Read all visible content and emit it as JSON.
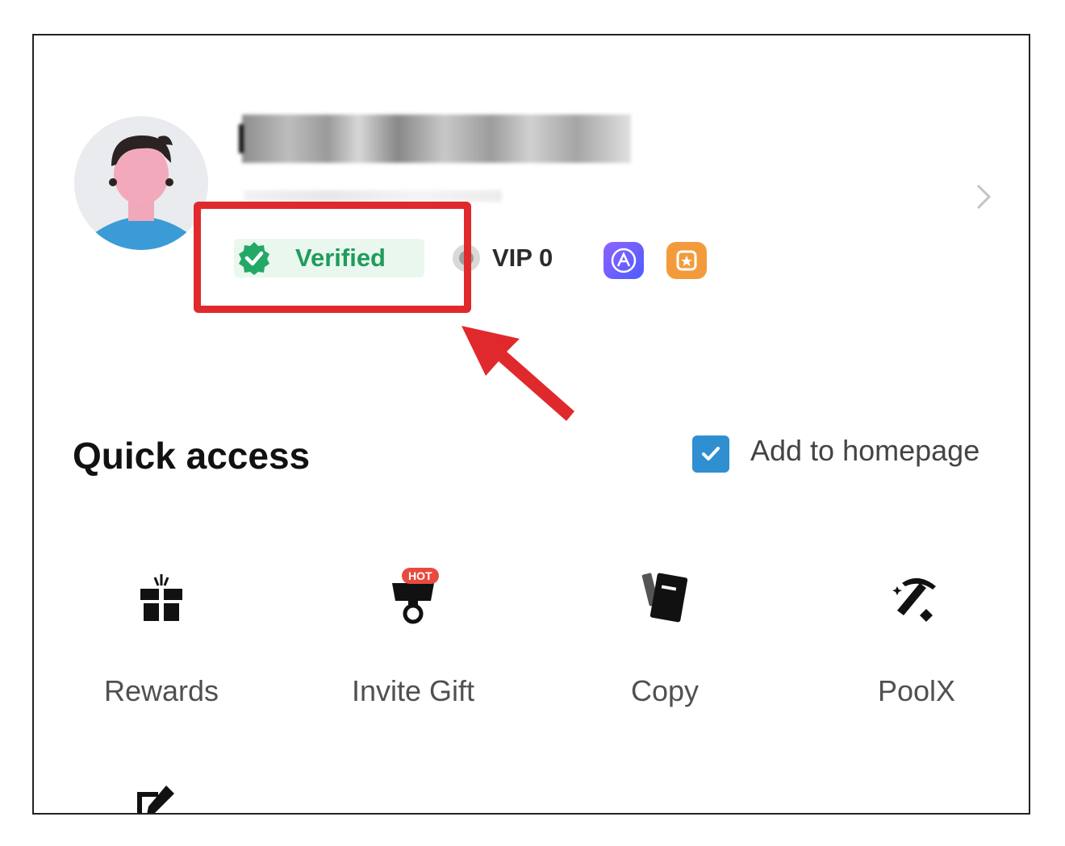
{
  "profile": {
    "avatar_icon": "user-avatar-icon",
    "verified_label": "Verified",
    "vip_label": "VIP 0",
    "chevron_icon": "chevron-right-icon",
    "colors": {
      "verified_bg": "#e9f7ef",
      "verified_text": "#1f9c5a"
    }
  },
  "badges": [
    {
      "icon": "purple-badge-icon",
      "color": "#6b5cff"
    },
    {
      "icon": "orange-badge-icon",
      "color": "#f39b3c"
    }
  ],
  "highlight": {
    "color": "#e0292c"
  },
  "quick_access": {
    "title": "Quick access",
    "add_to_homepage_label": "Add to homepage",
    "checkbox_checked": true,
    "items": [
      {
        "label": "Rewards",
        "icon": "gift-icon"
      },
      {
        "label": "Invite Gift",
        "icon": "invite-gift-icon",
        "badge": "HOT"
      },
      {
        "label": "Copy",
        "icon": "copy-book-icon"
      },
      {
        "label": "PoolX",
        "icon": "pickaxe-icon"
      }
    ],
    "partial_item_icon": "edit-icon"
  }
}
